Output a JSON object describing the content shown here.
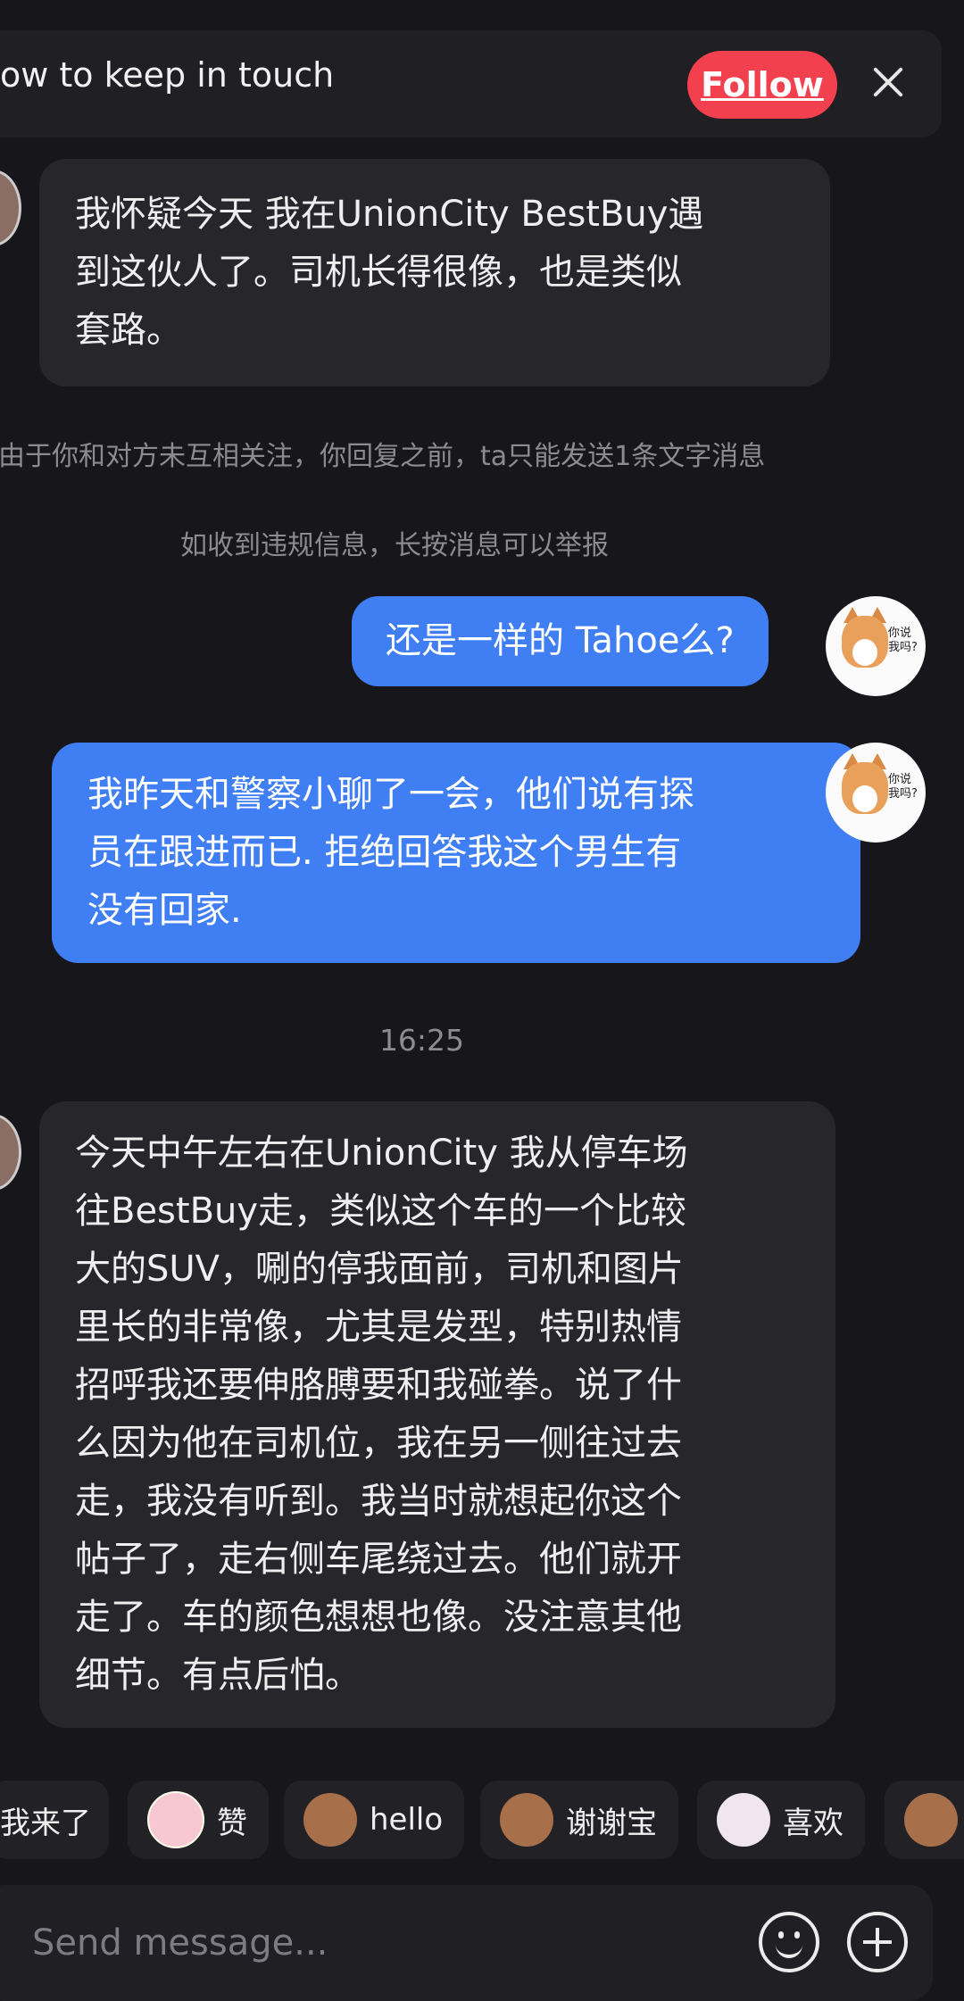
{
  "banner": {
    "text": "ow to keep in touch",
    "follow_label": "Follow"
  },
  "messages": {
    "incoming_1": "我怀疑今天 我在UnionCity BestBuy遇\n到这伙人了。司机长得很像，也是类似\n套路。",
    "notice_1": "由于你和对方未互相关注，你回复之前，ta只能发送1条文字消息",
    "notice_2": "如收到违规信息，长按消息可以举报",
    "outgoing_1": "还是一样的 Tahoe么?",
    "outgoing_2": "我昨天和警察小聊了一会，他们说有探\n员在跟进而已. 拒绝回答我这个男生有\n没有回家.",
    "timestamp": "16:25",
    "incoming_2": "今天中午左右在UnionCity 我从停车场\n往BestBuy走，类似这个车的一个比较\n大的SUV，唰的停我面前，司机和图片\n里长的非常像，尤其是发型，特别热情\n招呼我还要伸胳膊要和我碰拳。说了什\n么因为他在司机位，我在另一侧往过去\n走，我没有听到。我当时就想起你这个\n帖子了，走右侧车尾绕过去。他们就开\n走了。车的颜色想想也像。没注意其他\n细节。有点后怕。"
  },
  "avatar_text": "你说\n我吗?",
  "quick_replies": [
    "我来了",
    "赞",
    "hello",
    "谢谢宝",
    "喜欢"
  ],
  "input": {
    "placeholder": "Send message..."
  },
  "icons": [
    "close-icon",
    "emoji-icon",
    "plus-icon"
  ],
  "colors": {
    "follow": "#f2404f",
    "outgoing_bubble": "#3f7ef3",
    "incoming_bubble": "#26262b",
    "background": "#17171b"
  }
}
